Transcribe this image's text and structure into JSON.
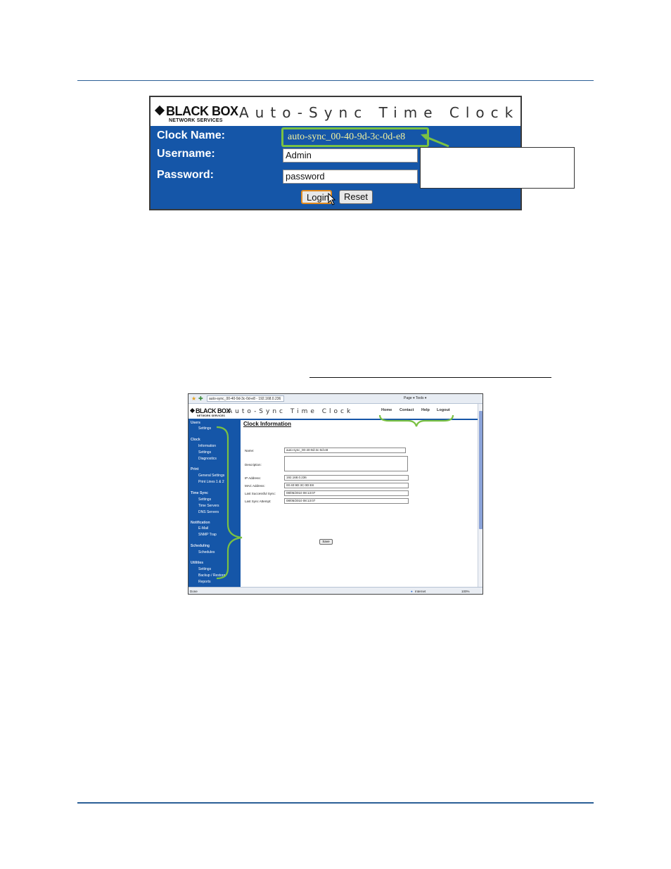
{
  "login_panel": {
    "logo_main": "BLACK BOX",
    "logo_sub": "NETWORK SERVICES",
    "app_title": "Auto-Sync Time Clock",
    "clock_name_label": "Clock Name:",
    "clock_name_value": "auto-sync_00-40-9d-3c-0d-e8",
    "username_label": "Username:",
    "username_value": "Admin",
    "password_label": "Password:",
    "password_value": "password",
    "login_button": "Login",
    "reset_button": "Reset"
  },
  "browser": {
    "tab_title": "auto-sync_00-40-9d-3c-0d-e8 - 192.168.0.236",
    "toolbar_text": "Page ▾  Tools ▾",
    "logo_main": "BLACK BOX",
    "logo_sub": "NETWORK SERVICES",
    "app_title": "Auto-Sync Time Clock",
    "nav": [
      "Home",
      "Contact",
      "Help",
      "Logout"
    ],
    "sidebar": [
      {
        "heading": "Users",
        "items": [
          "Settings"
        ]
      },
      {
        "heading": "Clock",
        "items": [
          "Information",
          "Settings",
          "Diagnostics"
        ]
      },
      {
        "heading": "Print",
        "items": [
          "General Settings",
          "Print Lines 1 & 2"
        ]
      },
      {
        "heading": "Time Sync",
        "items": [
          "Settings",
          "Time Servers",
          "DNS Servers"
        ]
      },
      {
        "heading": "Notification",
        "items": [
          "E-Mail",
          "SNMP Trap"
        ]
      },
      {
        "heading": "Scheduling",
        "items": [
          "Schedules"
        ]
      },
      {
        "heading": "Utilities",
        "items": [
          "Settings",
          "Backup / Restore",
          "Reports"
        ]
      }
    ],
    "content_title": "Clock Information",
    "fields": {
      "name_label": "Name:",
      "name_value": "auto-sync_00-40-9d-3c-0d-e8",
      "description_label": "Description:",
      "description_value": "",
      "ip_label": "IP Address:",
      "ip_value": "192.168.0.236",
      "mac_label": "MAC Address:",
      "mac_value": "00:40:9D:3C:0D:E8",
      "last_sync_label": "Last Successful Sync:",
      "last_sync_value": "08/05/2010 08:13:07",
      "last_attempt_label": "Last Sync Attempt:",
      "last_attempt_value": "08/05/2010 08:13:07"
    },
    "save_button": "Save",
    "status_left": "Done",
    "status_zone": "Internet",
    "status_zoom": "100%"
  },
  "colors": {
    "brand_blue": "#1556a8",
    "highlight_green": "#7ac143",
    "rule_blue": "#2b5f96"
  }
}
